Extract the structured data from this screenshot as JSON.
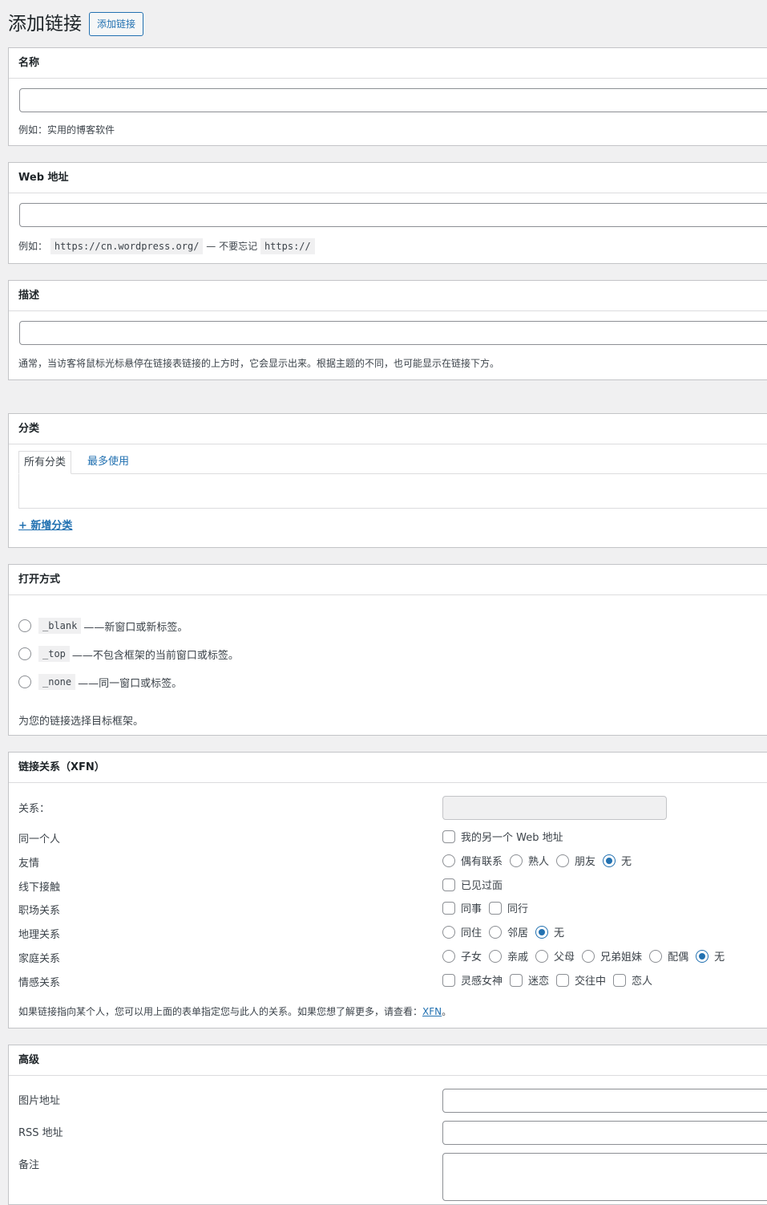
{
  "page": {
    "title": "添加链接",
    "add_button": "添加链接"
  },
  "name_box": {
    "title": "名称",
    "value": "",
    "hint": "例如：实用的博客软件"
  },
  "url_box": {
    "title": "Web 地址",
    "value": "",
    "hint_prefix": "例如：",
    "hint_code1": "https://cn.wordpress.org/",
    "hint_mid": "— 不要忘记",
    "hint_code2": "https://"
  },
  "desc_box": {
    "title": "描述",
    "value": "",
    "hint": "通常，当访客将鼠标光标悬停在链接表链接的上方时，它会显示出来。根据主题的不同，也可能显示在链接下方。"
  },
  "category_box": {
    "title": "分类",
    "tab_all": "所有分类",
    "tab_popular": "最多使用",
    "add_new": "+ 新增分类"
  },
  "target_box": {
    "title": "打开方式",
    "options": [
      {
        "code": "_blank",
        "desc": "——新窗口或新标签。",
        "checked": false
      },
      {
        "code": "_top",
        "desc": "——不包含框架的当前窗口或标签。",
        "checked": false
      },
      {
        "code": "_none",
        "desc": "——同一窗口或标签。",
        "checked": false
      }
    ],
    "hint": "为您的链接选择目标框架。"
  },
  "xfn_box": {
    "title": "链接关系（XFN）",
    "rel_label": "关系：",
    "rel_value": "",
    "rows": [
      {
        "label": "同一个人",
        "type": "checkbox",
        "options": [
          {
            "label": "我的另一个 Web 地址",
            "checked": false
          }
        ]
      },
      {
        "label": "友情",
        "type": "radio",
        "options": [
          {
            "label": "偶有联系",
            "checked": false
          },
          {
            "label": "熟人",
            "checked": false
          },
          {
            "label": "朋友",
            "checked": false
          },
          {
            "label": "无",
            "checked": true
          }
        ]
      },
      {
        "label": "线下接触",
        "type": "checkbox",
        "options": [
          {
            "label": "已见过面",
            "checked": false
          }
        ]
      },
      {
        "label": "职场关系",
        "type": "checkbox",
        "options": [
          {
            "label": "同事",
            "checked": false
          },
          {
            "label": "同行",
            "checked": false
          }
        ]
      },
      {
        "label": "地理关系",
        "type": "radio",
        "options": [
          {
            "label": "同住",
            "checked": false
          },
          {
            "label": "邻居",
            "checked": false
          },
          {
            "label": "无",
            "checked": true
          }
        ]
      },
      {
        "label": "家庭关系",
        "type": "radio",
        "options": [
          {
            "label": "子女",
            "checked": false
          },
          {
            "label": "亲戚",
            "checked": false
          },
          {
            "label": "父母",
            "checked": false
          },
          {
            "label": "兄弟姐妹",
            "checked": false
          },
          {
            "label": "配偶",
            "checked": false
          },
          {
            "label": "无",
            "checked": true
          }
        ]
      },
      {
        "label": "情感关系",
        "type": "checkbox",
        "options": [
          {
            "label": "灵感女神",
            "checked": false
          },
          {
            "label": "迷恋",
            "checked": false
          },
          {
            "label": "交往中",
            "checked": false
          },
          {
            "label": "恋人",
            "checked": false
          }
        ]
      }
    ],
    "hint_prefix": "如果链接指向某个人，您可以用上面的表单指定您与此人的关系。如果您想了解更多，请查看：",
    "hint_link": "XFN",
    "hint_suffix": "。"
  },
  "advanced_box": {
    "title": "高级",
    "image_label": "图片地址",
    "image_value": "",
    "rss_label": "RSS 地址",
    "rss_value": "",
    "notes_label": "备注",
    "notes_value": ""
  }
}
